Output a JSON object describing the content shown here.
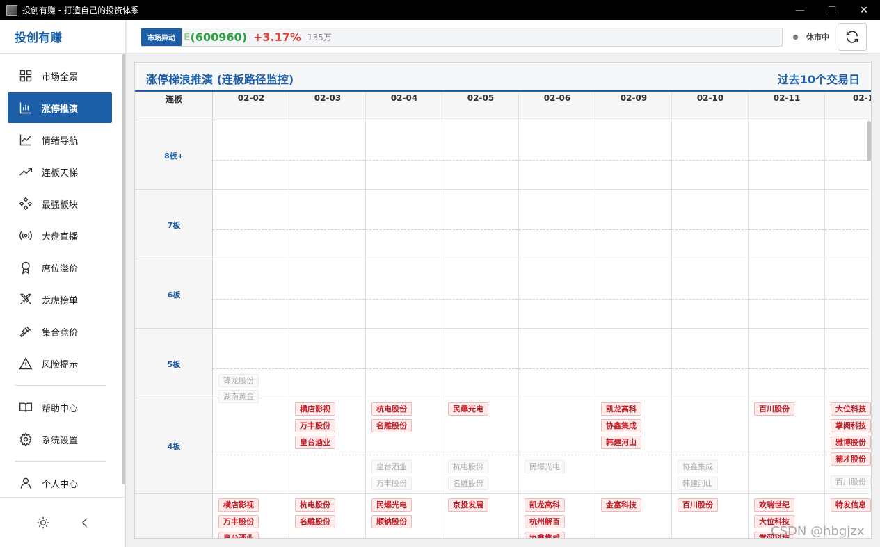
{
  "window": {
    "title": "投创有赚 - 打造自己的投资体系",
    "minimize": "—",
    "maximize": "☐",
    "close": "✕"
  },
  "sidebar": {
    "brand": "投创有赚",
    "items": [
      {
        "label": "市场全景",
        "icon": "grid-icon"
      },
      {
        "label": "涨停推演",
        "icon": "bar-chart-icon",
        "active": true
      },
      {
        "label": "情绪导航",
        "icon": "line-chart-icon"
      },
      {
        "label": "连板天梯",
        "icon": "trending-up-icon"
      },
      {
        "label": "最强板块",
        "icon": "diamonds-icon"
      },
      {
        "label": "大盘直播",
        "icon": "broadcast-icon"
      },
      {
        "label": "席位溢价",
        "icon": "award-icon"
      },
      {
        "label": "龙虎榜单",
        "icon": "swords-icon"
      },
      {
        "label": "集合竞价",
        "icon": "gavel-icon"
      },
      {
        "label": "风险提示",
        "icon": "warning-icon"
      },
      {
        "label": "帮助中心",
        "icon": "book-icon"
      },
      {
        "label": "系统设置",
        "icon": "gear-icon"
      },
      {
        "label": "个人中心",
        "icon": "user-icon"
      }
    ]
  },
  "ticker": {
    "tag": "市场异动",
    "partial_char": "E",
    "code": "(600960)",
    "change": "+3.17%",
    "volume": "135万"
  },
  "market_status": "休市中",
  "panel": {
    "title": "涨停梯浪推演 (连板路径监控)",
    "range": "过去10个交易日",
    "col_head": "连板",
    "dates": [
      "02-02",
      "02-03",
      "02-04",
      "02-05",
      "02-06",
      "02-09",
      "02-10",
      "02-11",
      "02-1"
    ],
    "rows": [
      "8板+",
      "7板",
      "6板",
      "5板",
      "4板"
    ],
    "faded_5": [
      "锋龙股份",
      "湖南黄金"
    ],
    "top_4": [
      [],
      [
        "横店影视",
        "万丰股份",
        "皇台酒业"
      ],
      [
        "杭电股份",
        "名雕股份"
      ],
      [
        "民爆光电"
      ],
      [],
      [
        "凯龙高科",
        "协鑫集成",
        "韩建河山"
      ],
      [],
      [
        "百川股份"
      ],
      [
        "大位科技",
        "掌阅科技",
        "雅博股份",
        "德才股份"
      ]
    ],
    "faded_4": [
      [],
      [],
      [
        "皇台酒业",
        "万丰股份"
      ],
      [
        "杭电股份",
        "名雕股份"
      ],
      [
        "民爆光电"
      ],
      [],
      [
        "协鑫集成",
        "韩建河山"
      ],
      [],
      [
        "百川股份"
      ]
    ],
    "top_3": [
      [
        "横店影视",
        "万丰股份",
        "皇台酒业"
      ],
      [
        "杭电股份",
        "名雕股份"
      ],
      [
        "民爆光电",
        "顺钠股份"
      ],
      [
        "京投发展"
      ],
      [
        "凯龙高科",
        "杭州解百",
        "协鑫集成"
      ],
      [
        "金富科技"
      ],
      [
        "百川股份"
      ],
      [
        "欢瑞世纪",
        "大位科技",
        "掌阅科技"
      ],
      [
        "特发信息"
      ]
    ]
  },
  "watermark": "CSDN @hbgjzx"
}
